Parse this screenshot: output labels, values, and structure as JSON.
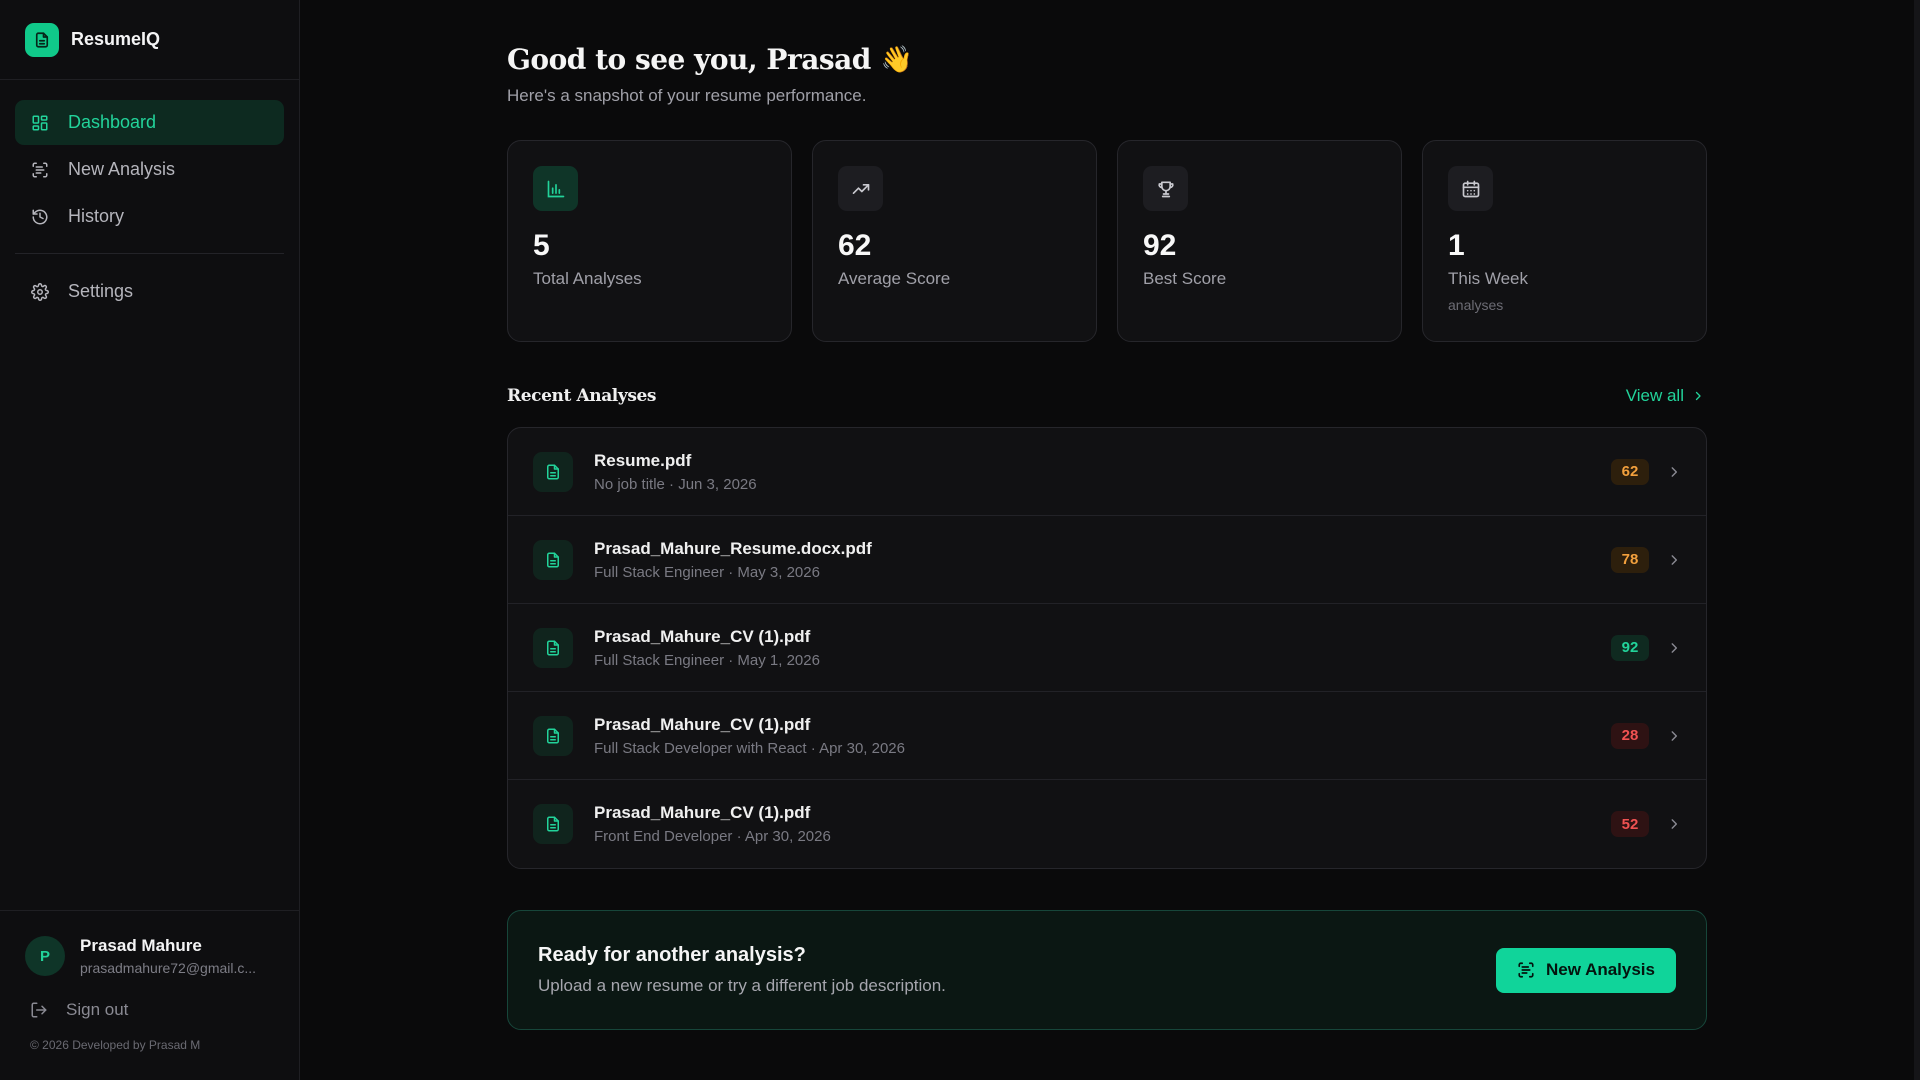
{
  "brand": {
    "name": "ResumeIQ"
  },
  "nav": {
    "dashboard": "Dashboard",
    "new_analysis": "New Analysis",
    "history": "History",
    "settings": "Settings"
  },
  "user": {
    "initial": "P",
    "name": "Prasad Mahure",
    "email": "prasadmahure72@gmail.c...",
    "sign_out": "Sign out",
    "copyright": "© 2026 Developed by Prasad M"
  },
  "header": {
    "greeting": "Good to see you, Prasad",
    "wave": "👋",
    "subtitle": "Here's a snapshot of your resume performance."
  },
  "stats": [
    {
      "value": "5",
      "label": "Total Analyses",
      "sub": "",
      "icon": "bar-chart-icon"
    },
    {
      "value": "62",
      "label": "Average Score",
      "sub": "",
      "icon": "trending-up-icon"
    },
    {
      "value": "92",
      "label": "Best Score",
      "sub": "",
      "icon": "trophy-icon"
    },
    {
      "value": "1",
      "label": "This Week",
      "sub": "analyses",
      "icon": "calendar-icon"
    }
  ],
  "recent": {
    "title": "Recent Analyses",
    "view_all": "View all",
    "items": [
      {
        "name": "Resume.pdf",
        "meta": "No job title · Jun 3, 2026",
        "score": "62"
      },
      {
        "name": "Prasad_Mahure_Resume.docx.pdf",
        "meta": "Full Stack Engineer · May 3, 2026",
        "score": "78"
      },
      {
        "name": "Prasad_Mahure_CV (1).pdf",
        "meta": "Full Stack Engineer · May 1, 2026",
        "score": "92"
      },
      {
        "name": "Prasad_Mahure_CV (1).pdf",
        "meta": "Full Stack Developer with React · Apr 30, 2026",
        "score": "28"
      },
      {
        "name": "Prasad_Mahure_CV (1).pdf",
        "meta": "Front End Developer · Apr 30, 2026",
        "score": "52"
      }
    ]
  },
  "cta": {
    "title": "Ready for another analysis?",
    "subtitle": "Upload a new resume or try a different job description.",
    "button": "New Analysis"
  },
  "colors": {
    "accent": "#10d49a",
    "score_high": "#22d39a",
    "score_mid": "#f2a03d",
    "score_low": "#f05252"
  }
}
